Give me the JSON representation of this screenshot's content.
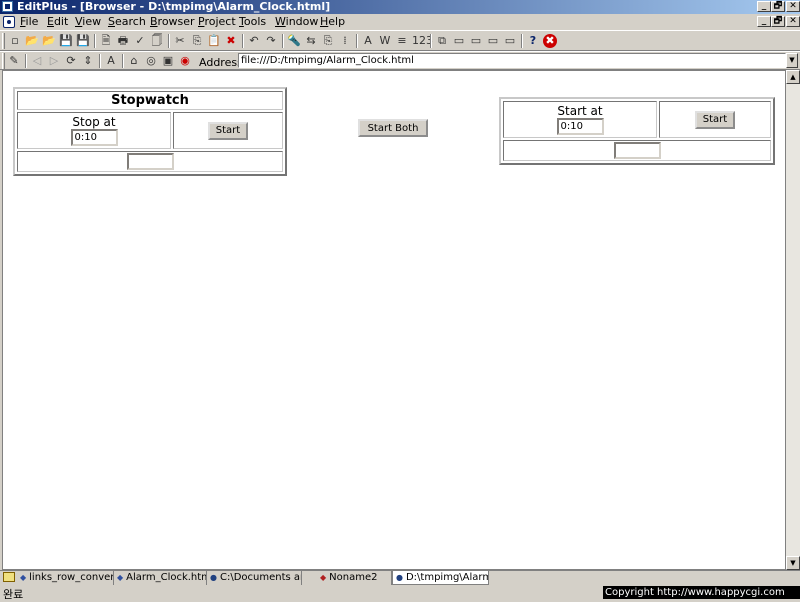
{
  "window": {
    "title": "EditPlus - [Browser - D:\\tmpimg\\Alarm_Clock.html]",
    "caption_buttons": [
      "_",
      "🗗",
      "✕"
    ],
    "mdi_buttons": [
      "_",
      "🗗",
      "✕"
    ]
  },
  "menubar": {
    "items": [
      {
        "label": "File",
        "key": "F",
        "rest": "ile"
      },
      {
        "label": "Edit",
        "key": "E",
        "rest": "dit"
      },
      {
        "label": "View",
        "key": "V",
        "rest": "iew"
      },
      {
        "label": "Search",
        "key": "S",
        "rest": "earch"
      },
      {
        "label": "Browser",
        "key": "B",
        "rest": "rowser"
      },
      {
        "label": "Project",
        "key": "P",
        "rest": "roject"
      },
      {
        "label": "Tools",
        "key": "T",
        "rest": "ools"
      },
      {
        "label": "Window",
        "key": "W",
        "rest": "indow"
      },
      {
        "label": "Help",
        "key": "H",
        "rest": "elp"
      }
    ]
  },
  "toolbar1": {
    "icons": [
      "new-file-icon",
      "open-icon",
      "open-remote-icon",
      "save-icon",
      "save-all-icon",
      "print-preview-icon",
      "print-icon",
      "spellcheck-icon",
      "html-preview-icon",
      "cut-icon",
      "copy-icon",
      "paste-icon",
      "delete-icon",
      "undo-icon",
      "redo-icon",
      "find-icon",
      "replace-icon",
      "copy-text-icon",
      "column-icon",
      "font-icon",
      "word-wrap-icon",
      "indent-icon",
      "line-number-icon",
      "screen-icon",
      "window-1-icon",
      "window-2-icon",
      "window-3-icon",
      "window-4-icon",
      "context-help-icon",
      "stop-icon"
    ],
    "glyphs": [
      "▫",
      "📂",
      "📂",
      "💾",
      "💾",
      "🗎",
      "🖶",
      "✓",
      "🗍",
      "✂",
      "⎘",
      "📋",
      "✖",
      "↶",
      "↷",
      "🔦",
      "⇆",
      "⎘",
      "⁞",
      "A",
      "W",
      "≡",
      "123",
      "⧉",
      "▭",
      "▭",
      "▭",
      "▭",
      "?",
      "✖"
    ]
  },
  "toolbar2": {
    "glyphs": [
      "✎",
      "◁",
      "▷",
      "⟳",
      "⇕",
      "A",
      "⌂",
      "◎",
      "▣",
      "◉"
    ],
    "icons": [
      "edit-icon",
      "back-icon",
      "forward-icon",
      "refresh-icon",
      "sync-icon",
      "font-size-icon",
      "home-icon",
      "search-web-icon",
      "favorites-icon",
      "stop-browser-icon"
    ],
    "address_label": "Address",
    "address_value": "file:///D:/tmpimg/Alarm_Clock.html"
  },
  "page": {
    "stopwatch": {
      "title": "Stopwatch",
      "stop_label": "Stop at",
      "stop_value": "0:10",
      "start_button": "Start",
      "display_value": ""
    },
    "start_both_button": "Start Both",
    "timer": {
      "start_label": "Start at",
      "start_value": "0:10",
      "start_button": "Start",
      "display_value": ""
    }
  },
  "tabs": [
    {
      "label": "links_row_convert.h",
      "icon": "folder-icon"
    },
    {
      "label": "Alarm_Clock.html",
      "icon": "html-file-icon"
    },
    {
      "label": "C:\\Documents an",
      "icon": "browser-icon"
    },
    {
      "label": "Noname2",
      "icon": "text-file-icon"
    },
    {
      "label": "D:\\tmpimg\\Alarm",
      "icon": "browser-icon"
    }
  ],
  "status": {
    "text": "완료",
    "copyright": "Copyright  http://www.happycgi.com"
  },
  "colors": {
    "titlebar_start": "#0a246a",
    "titlebar_end": "#a6caf0",
    "chrome": "#d4d0c8",
    "stop_icon": "#cc0000"
  }
}
